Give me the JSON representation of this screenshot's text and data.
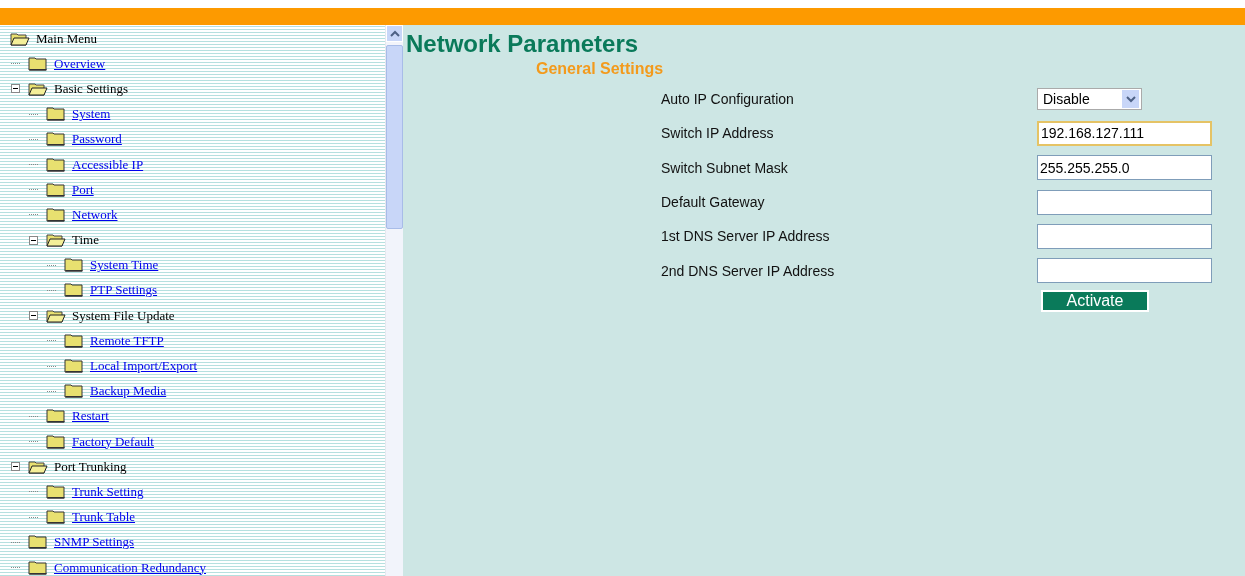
{
  "tree": {
    "label": "Main Menu",
    "children": [
      {
        "label": "Overview"
      },
      {
        "label": "Basic Settings",
        "expanded": true,
        "children": [
          {
            "label": "System"
          },
          {
            "label": "Password"
          },
          {
            "label": "Accessible IP"
          },
          {
            "label": "Port"
          },
          {
            "label": "Network"
          },
          {
            "label": "Time",
            "expanded": true,
            "children": [
              {
                "label": "System Time"
              },
              {
                "label": "PTP Settings"
              }
            ]
          },
          {
            "label": "System File Update",
            "expanded": true,
            "children": [
              {
                "label": "Remote TFTP"
              },
              {
                "label": "Local Import/Export"
              },
              {
                "label": "Backup Media"
              }
            ]
          },
          {
            "label": "Restart"
          },
          {
            "label": "Factory Default"
          }
        ]
      },
      {
        "label": "Port Trunking",
        "expanded": true,
        "children": [
          {
            "label": "Trunk Setting"
          },
          {
            "label": "Trunk Table"
          }
        ]
      },
      {
        "label": "SNMP Settings"
      },
      {
        "label": "Communication Redundancy"
      }
    ]
  },
  "page": {
    "title": "Network Parameters",
    "section": "General Settings",
    "fields": [
      {
        "label": "Auto IP Configuration",
        "kind": "select",
        "value": "Disable"
      },
      {
        "label": "Switch IP Address",
        "kind": "text",
        "value": "192.168.127.111",
        "focused": true
      },
      {
        "label": "Switch Subnet Mask",
        "kind": "text",
        "value": "255.255.255.0",
        "focused": false
      },
      {
        "label": "Default Gateway",
        "kind": "text",
        "focused": false
      },
      {
        "label": "1st DNS Server IP Address",
        "kind": "text",
        "focused": false
      },
      {
        "label": "2nd DNS Server IP Address",
        "kind": "text",
        "focused": false
      }
    ],
    "button": "Activate"
  }
}
